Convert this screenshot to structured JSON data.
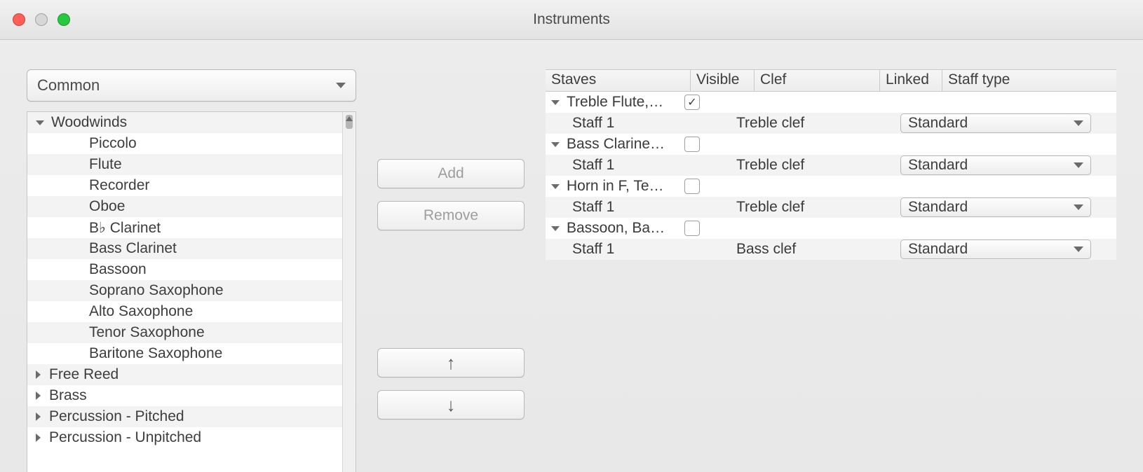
{
  "window": {
    "title": "Instruments"
  },
  "category": {
    "selected": "Common"
  },
  "tree": {
    "groups": [
      {
        "label": "Woodwinds",
        "expanded": true,
        "items": [
          "Piccolo",
          "Flute",
          "Recorder",
          "Oboe",
          "B♭ Clarinet",
          "Bass Clarinet",
          "Bassoon",
          "Soprano Saxophone",
          "Alto Saxophone",
          "Tenor Saxophone",
          "Baritone Saxophone"
        ]
      },
      {
        "label": "Free Reed",
        "expanded": false,
        "items": []
      },
      {
        "label": "Brass",
        "expanded": false,
        "items": []
      },
      {
        "label": "Percussion - Pitched",
        "expanded": false,
        "items": []
      },
      {
        "label": "Percussion - Unpitched",
        "expanded": false,
        "items": []
      }
    ]
  },
  "buttons": {
    "add": "Add",
    "remove": "Remove",
    "up": "↑",
    "down": "↓"
  },
  "grid": {
    "headers": {
      "staves": "Staves",
      "visible": "Visible",
      "clef": "Clef",
      "linked": "Linked",
      "stafftype": "Staff type"
    },
    "rows": [
      {
        "name": "Treble Flute,…",
        "visible": true,
        "staff_label": "Staff 1",
        "clef": "Treble clef",
        "stafftype": "Standard"
      },
      {
        "name": "Bass Clarine…",
        "visible": false,
        "staff_label": "Staff 1",
        "clef": "Treble clef",
        "stafftype": "Standard"
      },
      {
        "name": "Horn in F, Te…",
        "visible": false,
        "staff_label": "Staff 1",
        "clef": "Treble clef",
        "stafftype": "Standard"
      },
      {
        "name": "Bassoon, Ba…",
        "visible": false,
        "staff_label": "Staff 1",
        "clef": "Bass clef",
        "stafftype": "Standard"
      }
    ]
  }
}
